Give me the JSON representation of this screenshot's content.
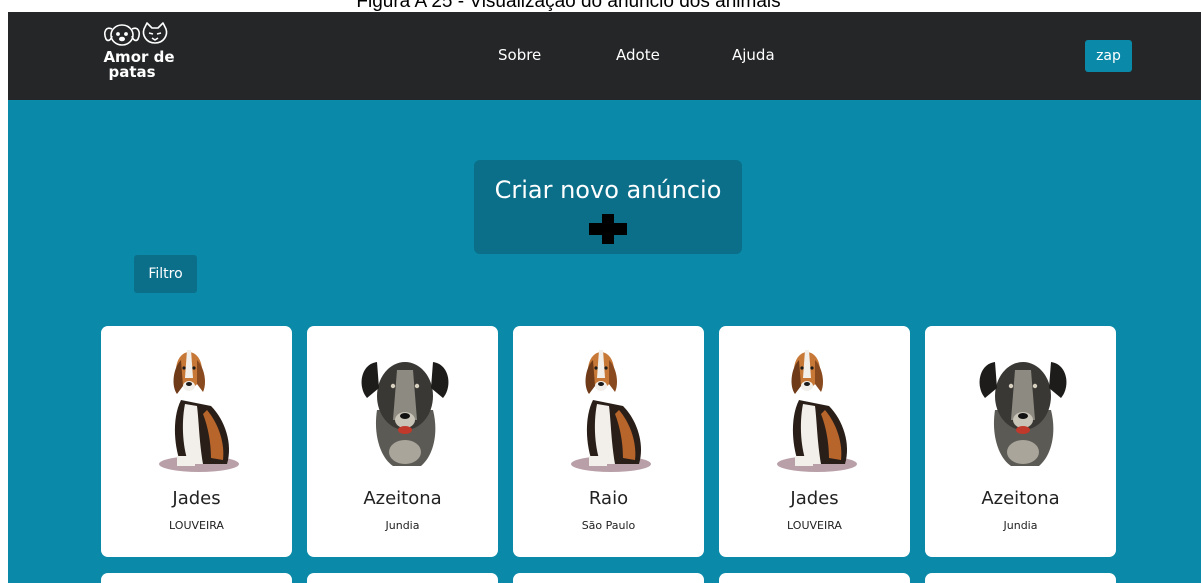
{
  "caption": "Figura A 25 - Visualização do anúncio dos animais",
  "brand": {
    "line1": "Amor de",
    "line2": "patas"
  },
  "nav": {
    "about": "Sobre",
    "adopt": "Adote",
    "help": "Ajuda"
  },
  "zap_label": "zap",
  "create_ad_label": "Criar novo anúncio",
  "filter_label": "Filtro",
  "pets": [
    {
      "name": "Jades",
      "city": "LOUVEIRA",
      "photo": "beagle"
    },
    {
      "name": "Azeitona",
      "city": "Jundia",
      "photo": "mixed-dog"
    },
    {
      "name": "Raio",
      "city": "São Paulo",
      "photo": "beagle"
    },
    {
      "name": "Jades",
      "city": "LOUVEIRA",
      "photo": "beagle"
    },
    {
      "name": "Azeitona",
      "city": "Jundia",
      "photo": "mixed-dog"
    }
  ],
  "colors": {
    "navbar": "#242628",
    "background": "#0a89a8",
    "panel": "#0b6f8a",
    "card": "#ffffff"
  }
}
